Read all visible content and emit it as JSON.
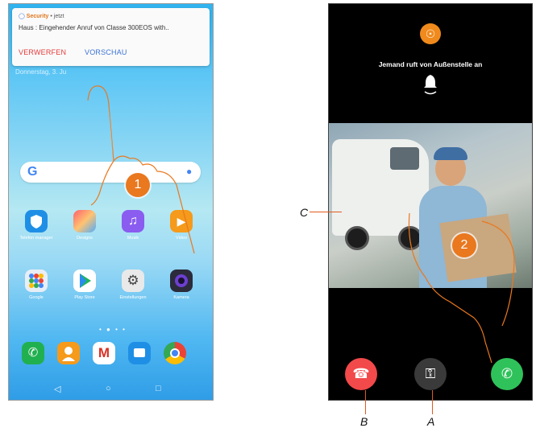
{
  "left_phone": {
    "notification": {
      "app_name": "Security",
      "time": "jetzt",
      "message": "Haus : Eingehender Anruf von Classe 300EOS with..",
      "dismiss_label": "VERWERFEN",
      "preview_label": "VORSCHAU"
    },
    "date": "Donnerstag, 3. Ju",
    "search": {
      "logo": "G"
    },
    "apps_row1": [
      {
        "label": "Telefon manager",
        "icon": "shield-icon"
      },
      {
        "label": "Designs",
        "icon": "brush-icon"
      },
      {
        "label": "Musik",
        "icon": "music-icon"
      },
      {
        "label": "Video",
        "icon": "play-icon"
      }
    ],
    "apps_row2": [
      {
        "label": "Google",
        "icon": "google-folder-icon"
      },
      {
        "label": "Play Store",
        "icon": "play-store-icon"
      },
      {
        "label": "Einstellungen",
        "icon": "settings-icon"
      },
      {
        "label": "Kamera",
        "icon": "camera-icon"
      }
    ],
    "dock": [
      "phone-icon",
      "contacts-icon",
      "gmail-icon",
      "messages-icon",
      "chrome-icon"
    ]
  },
  "right_phone": {
    "caller_text": "Jemand ruft von Außenstelle an"
  },
  "markers": {
    "step1": "1",
    "step2": "2"
  },
  "callouts": {
    "a": "A",
    "b": "B",
    "c": "C"
  },
  "colors": {
    "accent": "#e9781f",
    "decline": "#f2494b",
    "accept": "#2fc25b",
    "key": "#3a3a3a"
  }
}
